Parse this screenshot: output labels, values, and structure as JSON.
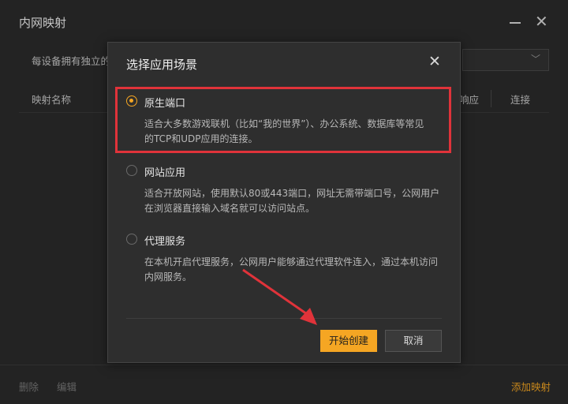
{
  "window": {
    "title": "内网映射",
    "description": "每设备拥有独立的",
    "header": {
      "name": "映射名称",
      "response": "响应",
      "connect": "连接"
    },
    "footer": {
      "delete": "删除",
      "edit": "编辑",
      "add": "添加映射"
    }
  },
  "modal": {
    "title": "选择应用场景",
    "options": [
      {
        "title": "原生端口",
        "desc_line1": "适合大多数游戏联机（比如“我的世界”）、办公系统、数据库等常见",
        "desc_line2": "的TCP和UDP应用的连接。",
        "selected": true
      },
      {
        "title": "网站应用",
        "desc_line1": "适合开放网站，使用默认80或443端口，网址无需带端口号，公网用户",
        "desc_line2": "在浏览器直接输入域名就可以访问站点。",
        "selected": false
      },
      {
        "title": "代理服务",
        "desc_line1": "在本机开启代理服务，公网用户能够通过代理软件连入，通过本机访问",
        "desc_line2": "内网服务。",
        "selected": false
      }
    ],
    "start_label": "开始创建",
    "cancel_label": "取消"
  },
  "colors": {
    "accent": "#f5a623",
    "highlight": "#e0333a"
  }
}
